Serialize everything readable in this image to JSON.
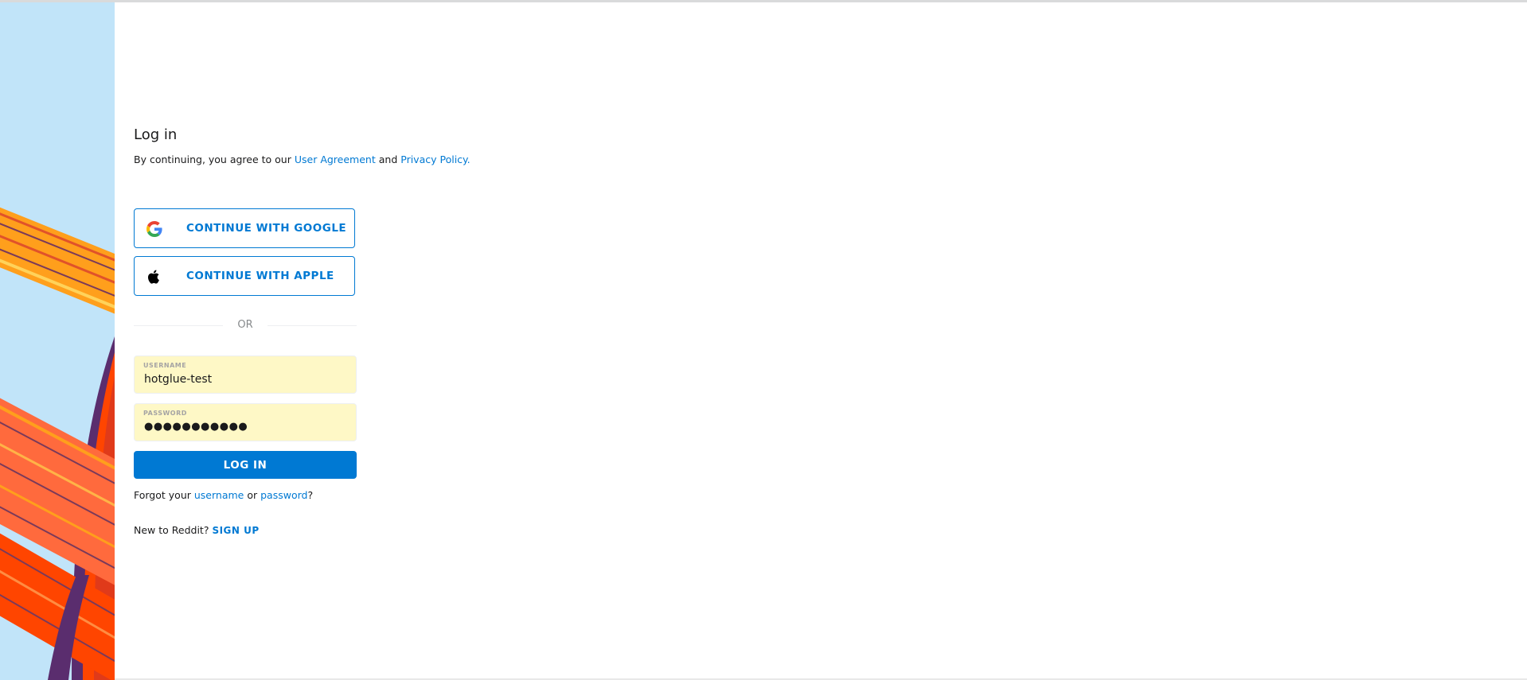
{
  "login": {
    "title": "Log in",
    "agreement_prefix": "By continuing, you agree to our",
    "user_agreement_link": "User Agreement",
    "and_text": "and",
    "privacy_policy_link": "Privacy Policy",
    "period": "."
  },
  "sso": {
    "google_label": "CONTINUE WITH GOOGLE",
    "apple_label": "CONTINUE WITH APPLE",
    "google_icon": "google-g-icon",
    "apple_icon": "apple-logo-icon"
  },
  "divider": {
    "text": "OR"
  },
  "form": {
    "username_label": "USERNAME",
    "username_value": "hotglue-test",
    "password_label": "PASSWORD",
    "password_masked": "●●●●●●●●●●●",
    "submit_label": "LOG IN"
  },
  "help": {
    "forgot_prefix": "Forgot your",
    "username_link": "username",
    "or_text": "or",
    "password_link": "password",
    "suffix": "?",
    "new_to_reddit": "New to Reddit?",
    "signup_link": "SIGN UP"
  },
  "colors": {
    "accent": "#0079d3",
    "autofill_background": "#fef8c6",
    "art_background": "#c1e4f9"
  }
}
